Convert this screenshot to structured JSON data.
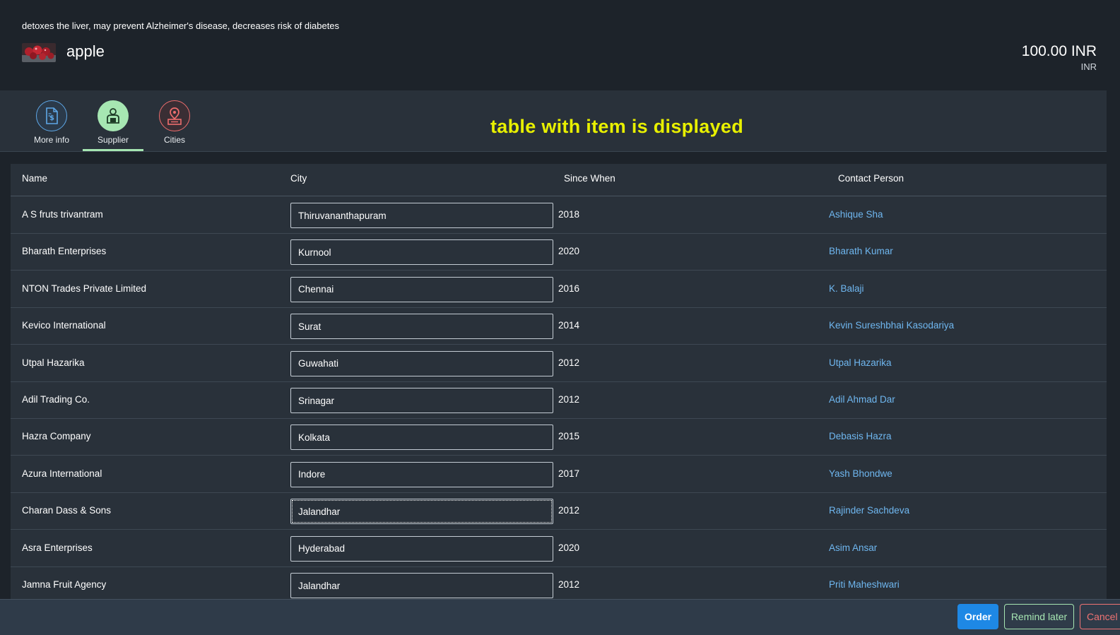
{
  "header": {
    "description": "detoxes the liver, may prevent Alzheimer's disease, decreases risk of diabetes",
    "title": "apple",
    "price": "100.00 INR",
    "currency": "INR"
  },
  "tabs": [
    {
      "label": "More info",
      "icon": "money-document-icon"
    },
    {
      "label": "Supplier",
      "icon": "supplier-icon"
    },
    {
      "label": "Cities",
      "icon": "map-pin-icon"
    }
  ],
  "banner": "table with item is displayed",
  "table": {
    "columns": [
      "Name",
      "City",
      "Since When",
      "Contact Person"
    ],
    "rows": [
      {
        "name": "A S fruts trivantram",
        "city": "Thiruvananthapuram",
        "since": "2018",
        "contact": "Ashique Sha"
      },
      {
        "name": "Bharath Enterprises",
        "city": "Kurnool",
        "since": "2020",
        "contact": "Bharath Kumar"
      },
      {
        "name": "NTON Trades Private Limited",
        "city": "Chennai",
        "since": "2016",
        "contact": "K. Balaji"
      },
      {
        "name": "Kevico International",
        "city": "Surat",
        "since": "2014",
        "contact": "Kevin Sureshbhai Kasodariya"
      },
      {
        "name": "Utpal Hazarika",
        "city": "Guwahati",
        "since": "2012",
        "contact": "Utpal Hazarika"
      },
      {
        "name": "Adil Trading Co.",
        "city": "Srinagar",
        "since": "2012",
        "contact": "Adil Ahmad Dar"
      },
      {
        "name": "Hazra Company",
        "city": "Kolkata",
        "since": "2015",
        "contact": "Debasis Hazra"
      },
      {
        "name": "Azura International",
        "city": "Indore",
        "since": "2017",
        "contact": "Yash Bhondwe"
      },
      {
        "name": "Charan Dass & Sons",
        "city": "Jalandhar",
        "since": "2012",
        "contact": "Rajinder Sachdeva"
      },
      {
        "name": "Asra Enterprises",
        "city": "Hyderabad",
        "since": "2020",
        "contact": "Asim Ansar"
      },
      {
        "name": "Jamna Fruit Agency",
        "city": "Jalandhar",
        "since": "2012",
        "contact": "Priti Maheshwari"
      }
    ]
  },
  "footer": {
    "order_label": "Order",
    "remind_label": "Remind later",
    "cancel_label": "Cancel"
  },
  "colors": {
    "accent_blue": "#1e88e5",
    "supplier_green": "#a6e6b2",
    "cities_red": "#ef6e6e",
    "banner_yellow": "#e8f000",
    "link_blue": "#6fb7f0"
  }
}
